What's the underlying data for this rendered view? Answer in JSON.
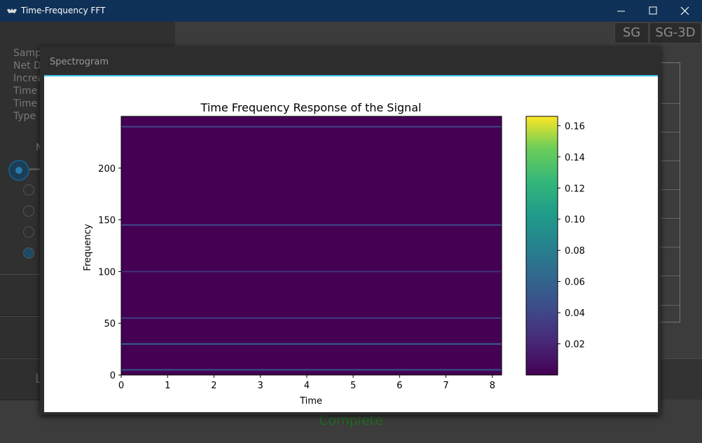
{
  "window": {
    "title": "Time-Frequency FFT",
    "icon": "kivy-app-icon"
  },
  "toolbar": {
    "sg_label": "SG",
    "sg3d_label": "SG-3D"
  },
  "left_panel": {
    "labels": [
      "Samp",
      "Net D",
      "Increa",
      "Time",
      "Time",
      "Type"
    ],
    "partial_label": "N",
    "bottom_button_partial": "L"
  },
  "status": {
    "text": "Complete",
    "color": "#206b20"
  },
  "modal": {
    "title": "Spectrogram",
    "accent": "#37c1e3"
  },
  "chart_data": {
    "type": "heatmap",
    "title": "Time Frequency Response of the Signal",
    "xlabel": "Time",
    "ylabel": "Frequency",
    "xlim": [
      0,
      8.2
    ],
    "ylim": [
      0,
      250
    ],
    "xticks": [
      0,
      1,
      2,
      3,
      4,
      5,
      6,
      7,
      8
    ],
    "yticks": [
      0,
      50,
      100,
      150,
      200
    ],
    "colormap": "viridis",
    "background_color": "#440154",
    "colorbar": {
      "ticks": [
        0.02,
        0.04,
        0.06,
        0.08,
        0.1,
        0.12,
        0.14,
        0.16
      ],
      "tick_labels": [
        "0.02",
        "0.04",
        "0.06",
        "0.08",
        "0.10",
        "0.12",
        "0.14",
        "0.16"
      ],
      "range": [
        0.0,
        0.166
      ]
    },
    "bands": [
      {
        "frequency": 5,
        "intensity": 0.05
      },
      {
        "frequency": 30,
        "intensity": 0.06
      },
      {
        "frequency": 55,
        "intensity": 0.035
      },
      {
        "frequency": 100,
        "intensity": 0.025
      },
      {
        "frequency": 145,
        "intensity": 0.04
      },
      {
        "frequency": 240,
        "intensity": 0.04
      }
    ]
  }
}
